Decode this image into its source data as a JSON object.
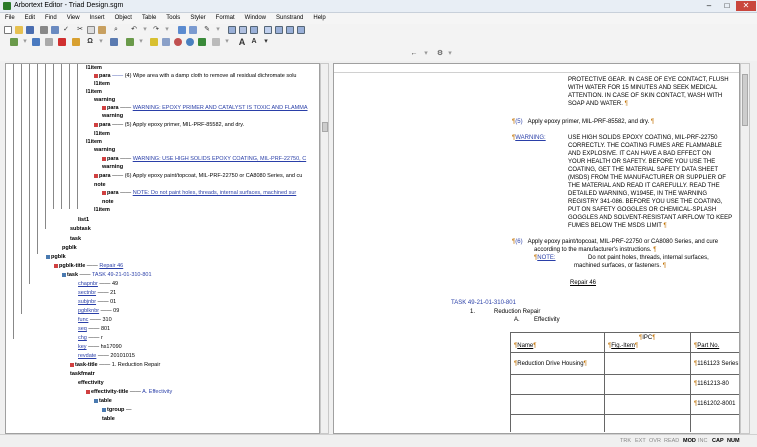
{
  "window": {
    "title": "Arbortext Editor - Triad Design.sgm",
    "minimize": "–",
    "maximize": "□",
    "close": "✕"
  },
  "menu": [
    "File",
    "Edit",
    "Find",
    "View",
    "Insert",
    "Object",
    "Table",
    "Tools",
    "Styler",
    "Format",
    "Window",
    "Sunstrand",
    "Help"
  ],
  "tree": {
    "l1": "(4) Wipe area with a damp cloth to remove all residual dichromate solu",
    "l2": "warning",
    "l3": "WARNING: EPOXY PRIMER AND CATALYST IS TOXIC AND FLAMMA",
    "l4": "(5) Apply epoxy primer, MIL-PRF-85582, and dry.",
    "l5": "WARNING: USE HIGH SOLIDS EPOXY COATING, MIL-PRF-22750, C",
    "l6": "(6) Apply epoxy paint/topcoat, MIL-PRF-22750 or CA8080 Series, and cu",
    "l7": "NOTE: Do not paint holes, threads, internal surfaces, machined sur",
    "pgblk_title_val": "Repair 46",
    "task_val": "TASK 49-21-01-310-801",
    "chapnbr": "49",
    "sectnbr": "21",
    "subjnbr": "01",
    "pgblknbr": "09",
    "func": "310",
    "seq": "801",
    "chg": "r",
    "key": "hs17090",
    "revdate": "20101015",
    "task_title_val": "1. Reduction Repair",
    "eff_title_val": "A. Effectivity"
  },
  "doc": {
    "p1": [
      "PROTECTIVE GEAR. IN CASE OF EYE CONTACT, FLUSH",
      "WITH WATER FOR 15 MINUTES AND SEEK MEDICAL",
      "ATTENTION. IN CASE OF SKIN CONTACT, WASH WITH",
      "SOAP AND WATER."
    ],
    "s5_num": "(5)",
    "s5_text": "Apply epoxy primer, MIL-PRF-85582, and dry.",
    "warning_label": "WARNING:",
    "warn": [
      "USE HIGH SOLIDS EPOXY COATING, MIL-PRF-22750",
      "CORRECTLY. THE COATING FUMES ARE FLAMMABLE",
      "AND EXPLOSIVE. IT CAN HAVE A BAD EFFECT ON",
      "YOUR HEALTH OR SAFETY. BEFORE YOU USE THE",
      "COATING, GET THE MATERIAL SAFETY DATA SHEET",
      "(MSDS) FROM THE MANUFACTURER OR SUPPLIER OF",
      "THE MATERIAL AND READ IT CAREFULLY. READ THE",
      "DETAILED WARNING, W1945E, IN THE WARNING",
      "REGISTRY 341-086. BEFORE YOU USE THE COATING,",
      "PUT ON SAFETY GOGGLES OR CHEMICAL-SPLASH",
      "GOGGLES AND SOLVENT-RESISTANT AIRFLOW TO KEEP",
      "FUMES BELOW THE MSDS LIMIT"
    ],
    "s6_num": "(6)",
    "s6_text": [
      "Apply epoxy paint/topcoat, MIL-PRF-22750 or CA8080 Series, and cure",
      "according to the manufacturer's instructions."
    ],
    "note_label": "NOTE:",
    "note": [
      "Do not paint holes, threads, internal surfaces,",
      "machined surfaces, or fasteners."
    ],
    "repair": "Repair 46",
    "task": "TASK 49-21-01-310-801",
    "t1_num": "1.",
    "t1": "Reduction Repair",
    "tA_num": "A.",
    "tA": "Effectivity",
    "ipc": "IPC",
    "col_name": "Name",
    "col_fig": "Fig.-Item",
    "col_part": "Part No.",
    "r1_name": "Reduction Drive Housing",
    "r1_part": "1161123 Series",
    "r2_part": "1161213-80",
    "r3_part": "1161202-8001"
  },
  "status": [
    "TRK",
    "EXT",
    "OVR",
    "READ",
    "MOD",
    "INC",
    "CAP",
    "NUM"
  ]
}
